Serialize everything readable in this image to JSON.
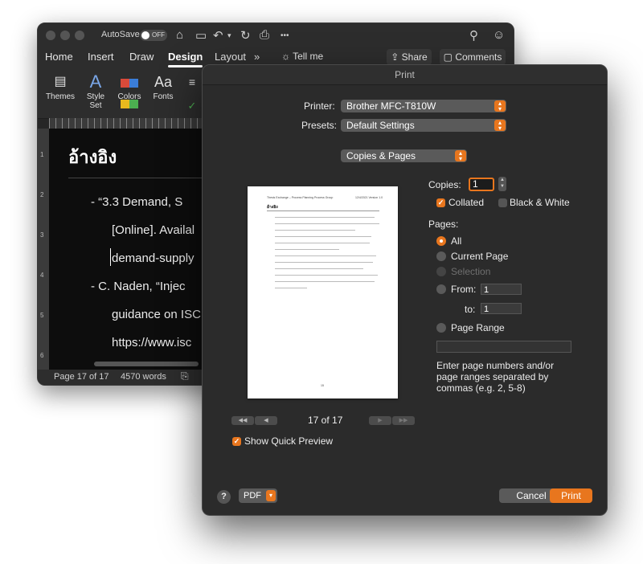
{
  "word": {
    "autosave_label": "AutoSave",
    "autosave_state": "OFF",
    "tabs": [
      "Home",
      "Insert",
      "Draw",
      "Design",
      "Layout"
    ],
    "active_tab": "Design",
    "more_tabs": "»",
    "tell_me": "Tell me",
    "share_label": "Share",
    "comments_label": "Comments",
    "ribbon": {
      "themes": "Themes",
      "style_set_1": "Style",
      "style_set_2": "Set",
      "colors": "Colors",
      "fonts": "Fonts"
    },
    "ruler_numbers": [
      "1",
      "2",
      "3",
      "4",
      "5",
      "6"
    ],
    "document": {
      "heading": "อ้างอิง",
      "lines": [
        "-     “3.3 Demand, S",
        "[Online]. Availal",
        "demand-supply",
        "-     C. Naden, “Injec",
        "guidance on ISC",
        "https://www.isc"
      ]
    },
    "status": {
      "page": "Page 17 of 17",
      "words": "4570 words"
    }
  },
  "print": {
    "title": "Print",
    "printer_label": "Printer:",
    "printer_value": "Brother MFC-T810W",
    "presets_label": "Presets:",
    "presets_value": "Default Settings",
    "section_value": "Copies & Pages",
    "copies_label": "Copies:",
    "copies_value": "1",
    "collated_label": "Collated",
    "collated_checked": true,
    "bw_label": "Black & White",
    "bw_checked": false,
    "pages_label": "Pages:",
    "page_options": {
      "all": "All",
      "current": "Current Page",
      "selection": "Selection",
      "from": "From:",
      "to": "to:",
      "range": "Page Range"
    },
    "from_value": "1",
    "to_value": "1",
    "range_help": "Enter page numbers and/or page ranges separated by commas (e.g. 2, 5-8)",
    "page_counter": "17 of 17",
    "show_quick_preview": "Show Quick Preview",
    "pdf_label": "PDF",
    "cancel_label": "Cancel",
    "print_label": "Print",
    "help_label": "?",
    "preview": {
      "header_left": "Thesis Exchange – Process Planning Process Group",
      "header_right": "12/4/2021   Version 1.0",
      "heading": "อ้างอิง",
      "footer": "15"
    }
  },
  "accent_color": "#e8761e"
}
